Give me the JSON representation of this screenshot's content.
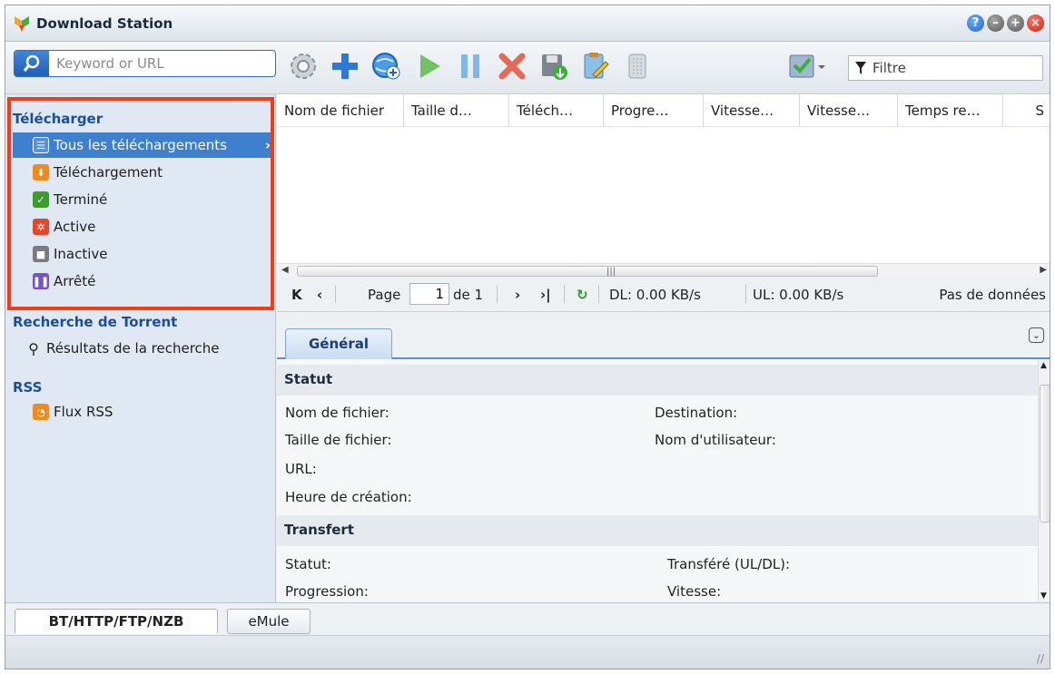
{
  "window": {
    "title": "Download Station"
  },
  "window_buttons": [
    "help",
    "minimize",
    "maximize",
    "close"
  ],
  "search": {
    "placeholder": "Keyword or URL"
  },
  "toolbar": {
    "icons": [
      "settings-icon",
      "add-icon",
      "add-url-icon",
      "resume-icon",
      "pause-icon",
      "delete-icon",
      "save-icon",
      "edit-icon",
      "clear-icon",
      "select-icon"
    ],
    "filter_placeholder": "Filtre"
  },
  "sidebar": {
    "section_download": "Télécharger",
    "items": [
      {
        "label": "Tous les téléchargements",
        "icon": "list-icon",
        "color": "#3e7fce",
        "chevron": "›"
      },
      {
        "label": "Téléchargement",
        "icon": "download-icon",
        "color": "#f08a1c"
      },
      {
        "label": "Terminé",
        "icon": "check-icon",
        "color": "#3e9b2e"
      },
      {
        "label": "Active",
        "icon": "active-icon",
        "color": "#e0492b"
      },
      {
        "label": "Inactive",
        "icon": "inactive-icon",
        "color": "#7b7b7b"
      },
      {
        "label": "Arrêté",
        "icon": "stopped-icon",
        "color": "#7a52c7"
      }
    ],
    "section_torrent": "Recherche de Torrent",
    "torrent_item": "Résultats de la recherche",
    "section_rss": "RSS",
    "rss_item": "Flux RSS"
  },
  "grid": {
    "columns": [
      "Nom de fichier",
      "Taille d…",
      "Téléch…",
      "Progre…",
      "Vitesse…",
      "Vitesse…",
      "Temps re…",
      "S"
    ]
  },
  "pager": {
    "page_label": "Page",
    "page_value": "1",
    "of_label": "de 1",
    "dl": "DL: 0.00 KB/s",
    "ul": "UL: 0.00 KB/s",
    "no_data": "Pas de données"
  },
  "detail": {
    "tab": "Général",
    "status_head": "Statut",
    "filename": "Nom de fichier:",
    "destination": "Destination:",
    "filesize": "Taille de fichier:",
    "username": "Nom d'utilisateur:",
    "url": "URL:",
    "created": "Heure de création:",
    "transfer_head": "Transfert",
    "status": "Statut:",
    "transferred": "Transféré (UL/DL):",
    "progress": "Progression:",
    "speed": "Vitesse:"
  },
  "bottom_tabs": [
    "BT/HTTP/FTP/NZB",
    "eMule"
  ],
  "colors": {
    "accent": "#3e7fce",
    "highlight": "#f23b18",
    "section_text": "#1a4e98"
  }
}
